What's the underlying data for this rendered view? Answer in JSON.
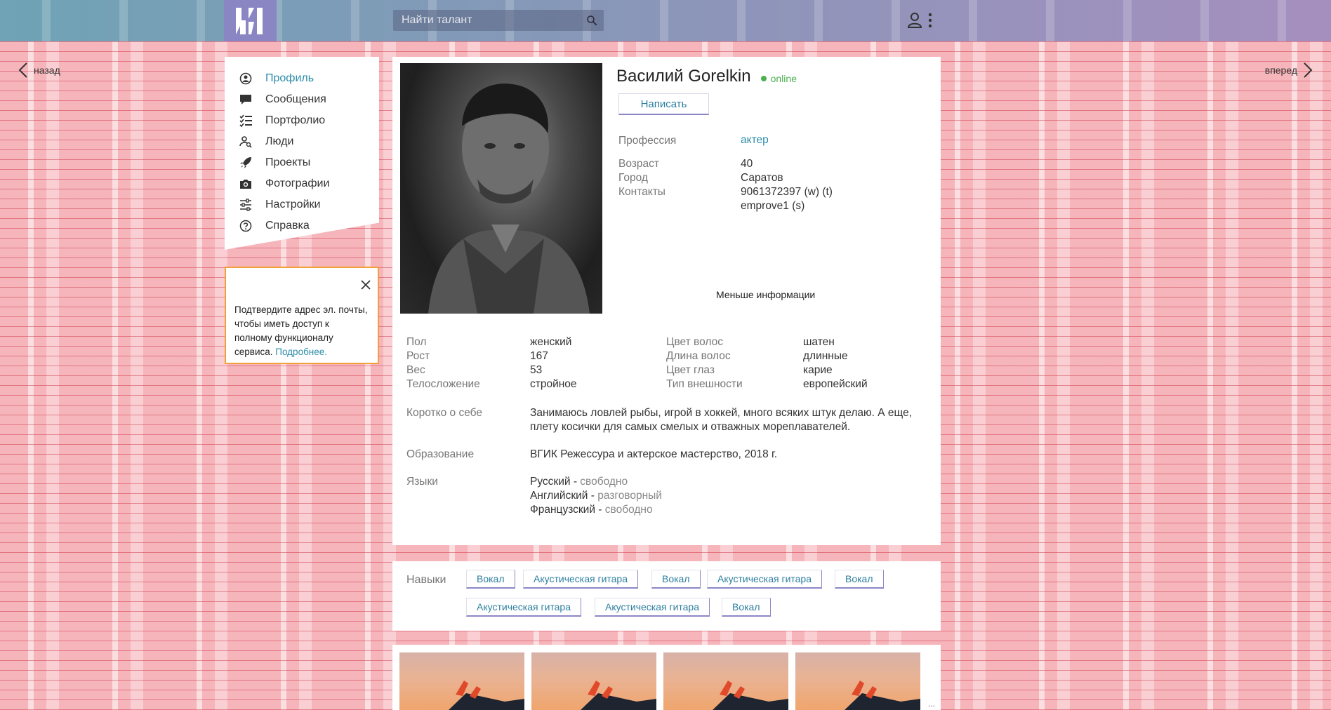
{
  "topbar": {
    "search_placeholder": "Найти талант"
  },
  "nav": {
    "back_label": "назад",
    "forward_label": "вперед"
  },
  "menu": {
    "items": [
      {
        "label": "Профиль",
        "icon": "user-circle-icon",
        "active": true
      },
      {
        "label": "Сообщения",
        "icon": "chat-icon"
      },
      {
        "label": "Портфолио",
        "icon": "checklist-icon"
      },
      {
        "label": "Люди",
        "icon": "people-search-icon"
      },
      {
        "label": "Проекты",
        "icon": "rocket-icon"
      },
      {
        "label": "Фотографии",
        "icon": "camera-icon"
      },
      {
        "label": "Настройки",
        "icon": "sliders-icon"
      },
      {
        "label": "Справка",
        "icon": "help-icon"
      }
    ]
  },
  "notice": {
    "text": "Подтвердите адрес эл. почты, чтобы иметь доступ к полному функционалу сервиса.",
    "link": "Подробнее."
  },
  "profile": {
    "name": "Василий Gorelkin",
    "status": "online",
    "write_button": "Написать",
    "profession_label": "Профессия",
    "profession_value": "актер",
    "age_label": "Возраст",
    "age_value": "40",
    "city_label": "Город",
    "city_value": "Саратов",
    "contacts_label": "Контакты",
    "contacts_line1": "9061372397 (w) (t)",
    "contacts_line2": "emprove1 (s)",
    "less_info": "Меньше информации"
  },
  "details": {
    "left": [
      {
        "k": "Пол",
        "v": "женский"
      },
      {
        "k": "Рост",
        "v": "167"
      },
      {
        "k": "Вес",
        "v": "53"
      },
      {
        "k": "Телосложение",
        "v": "стройное"
      }
    ],
    "right": [
      {
        "k": "Цвет волос",
        "v": "шатен"
      },
      {
        "k": "Длина волос",
        "v": "длинные"
      },
      {
        "k": "Цвет глаз",
        "v": "карие"
      },
      {
        "k": "Тип внешности",
        "v": "европейский"
      }
    ],
    "about_label": "Коротко о себе",
    "about_text": "Занимаюсь ловлей рыбы, игрой в хоккей, много всяких штук делаю. А еще, плету косички для самых смелых и отважных мореплавателей.",
    "education_label": "Образование",
    "education_text": "ВГИК Режессура и актерское мастерство, 2018 г.",
    "languages_label": "Языки",
    "languages": [
      {
        "name": "Русский",
        "sep": " - ",
        "level": "свободно"
      },
      {
        "name": "Английский",
        "sep": " - ",
        "level": "разговорный"
      },
      {
        "name": "Французский",
        "sep": " - ",
        "level": "свободно"
      }
    ]
  },
  "skills": {
    "label": "Навыки",
    "tags": [
      "Вокал",
      "Акустическая гитара",
      "Вокал",
      "Акустическая гитара",
      "Вокал",
      "Акустическая гитара",
      "Акустическая гитара",
      "Вокал"
    ]
  },
  "gallery": {
    "more": "..."
  },
  "colors": {
    "accent": "#2d8ca8",
    "online": "#4caf50",
    "notice_border": "#f2a13a",
    "button_underline": "#8b87c5"
  }
}
